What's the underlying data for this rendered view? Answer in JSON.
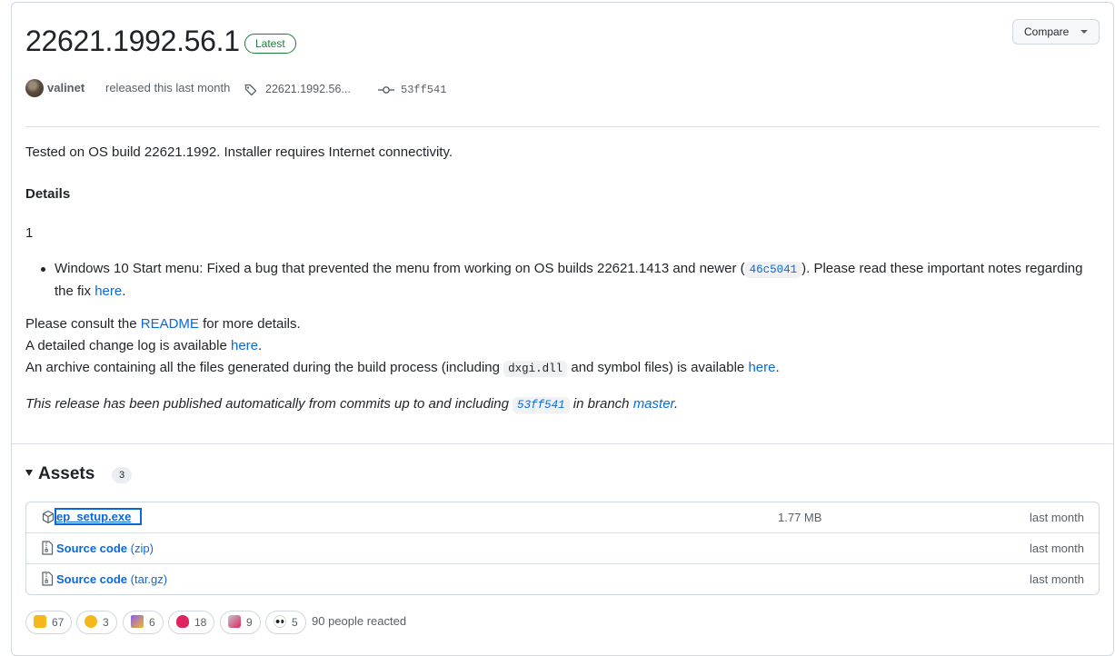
{
  "release": {
    "title": "22621.1992.56.1",
    "latest_label": "Latest",
    "compare_label": "Compare",
    "author": "valinet",
    "released_text": "released this last month",
    "tag_name": "22621.1992.56...",
    "commit_sha": "53ff541"
  },
  "notes": {
    "tested_line": "Tested on OS build 22621.1992. Installer requires Internet connectivity.",
    "details_heading": "Details",
    "counter": "1",
    "bullet": {
      "text_before": "Windows 10 Start menu: Fixed a bug that prevented the menu from working on OS builds 22621.1413 and newer (",
      "commit": "46c5041",
      "text_after": "). Please read these important notes regarding the fix ",
      "link": "here",
      "end": "."
    },
    "consult": {
      "before": "Please consult the ",
      "link": "README",
      "after": " for more details."
    },
    "changelog": {
      "before": "A detailed change log is available ",
      "link": "here",
      "after": "."
    },
    "archive": {
      "before": "An archive containing all the files generated during the build process (including ",
      "code": "dxgi.dll",
      "middle": " and symbol files) is available ",
      "link": "here",
      "after": "."
    },
    "published": {
      "before": "This release has been published automatically from commits up to and including ",
      "commit": "53ff541",
      "middle": " in branch ",
      "branch": "master",
      "after": "."
    }
  },
  "assets": {
    "label": "Assets",
    "count": "3",
    "items": [
      {
        "name": "ep_setup.exe",
        "suffix": "",
        "size": "1.77 MB",
        "date": "last month",
        "icon": "package-icon"
      },
      {
        "name": "Source code",
        "suffix": " (zip)",
        "size": "",
        "date": "last month",
        "icon": "file-zip-icon"
      },
      {
        "name": "Source code",
        "suffix": " (tar.gz)",
        "size": "",
        "date": "last month",
        "icon": "file-zip-icon"
      }
    ]
  },
  "reactions": {
    "items": [
      {
        "emoji": "thumbs-up",
        "count": "67",
        "color": "#f5b81c"
      },
      {
        "emoji": "laugh",
        "count": "3",
        "color": "#f5b81c"
      },
      {
        "emoji": "hooray",
        "count": "6",
        "color": "#8b5cf6"
      },
      {
        "emoji": "heart",
        "count": "18",
        "color": "#e0245e"
      },
      {
        "emoji": "rocket",
        "count": "9",
        "color": "#c0c7d0"
      },
      {
        "emoji": "eyes",
        "count": "5",
        "color": "#ffffff"
      }
    ],
    "summary": "90 people reacted"
  }
}
